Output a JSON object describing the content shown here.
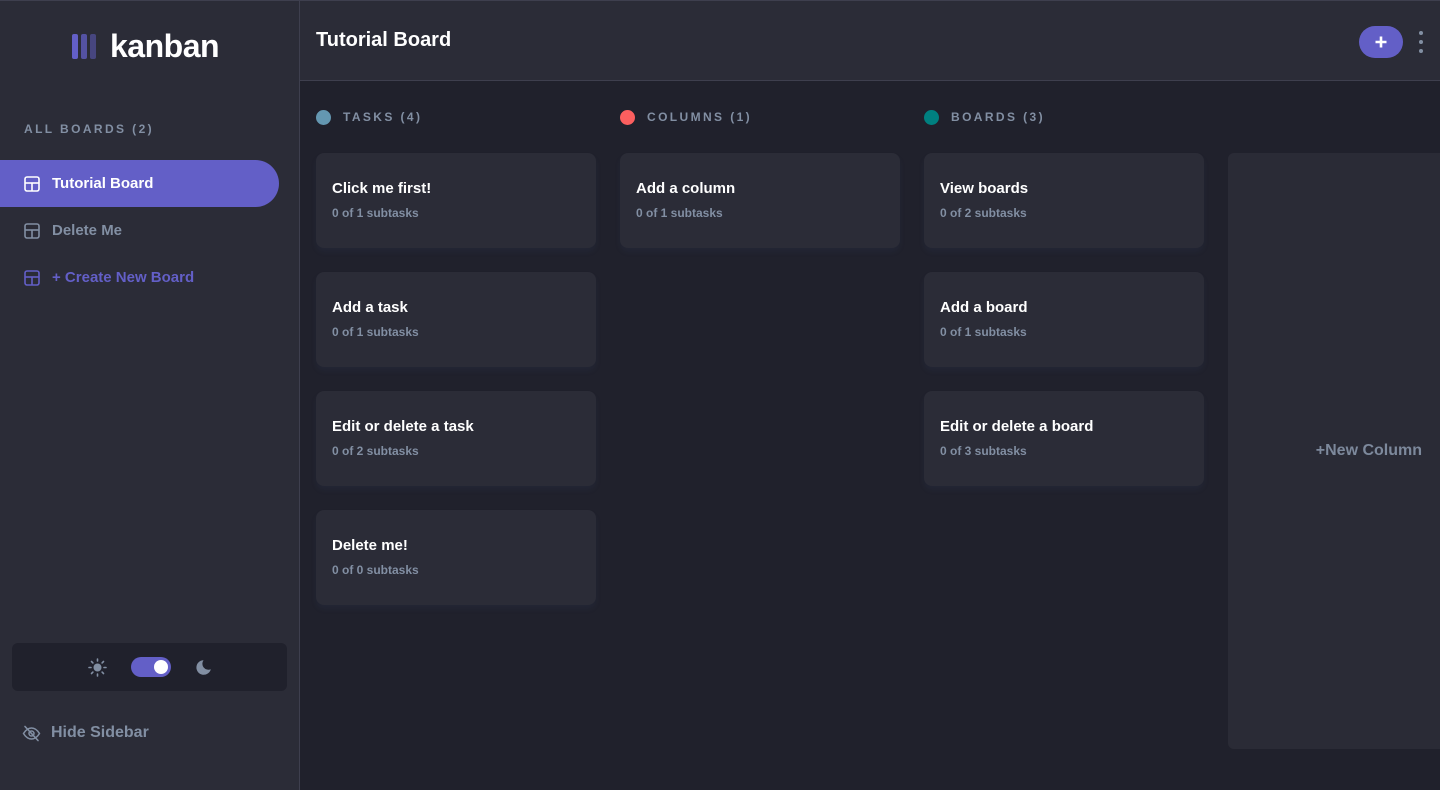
{
  "colors": {
    "accent": "#635fc7",
    "panel": "#2b2c37",
    "background": "#20212c",
    "muted_text": "#828fa3",
    "text": "#ffffff"
  },
  "logo": {
    "text": "kanban"
  },
  "sidebar": {
    "heading": "ALL BOARDS (2)",
    "boards": [
      {
        "label": "Tutorial Board",
        "active": true
      },
      {
        "label": "Delete Me",
        "active": false
      }
    ],
    "create_label": "+ Create New Board",
    "theme": {
      "mode": "dark",
      "light_icon": "sun-icon",
      "dark_icon": "moon-icon"
    },
    "hide_label": "Hide Sidebar"
  },
  "header": {
    "title": "Tutorial Board",
    "add_task_icon": "plus-icon",
    "menu_icon": "vertical-ellipsis-icon"
  },
  "columns": [
    {
      "name": "TASKS (4)",
      "color": "#6497b1",
      "tasks": [
        {
          "title": "Click me first!",
          "subtasks": "0 of 1 subtasks"
        },
        {
          "title": "Add a task",
          "subtasks": "0 of 1 subtasks"
        },
        {
          "title": "Edit or delete a task",
          "subtasks": "0 of 2 subtasks"
        },
        {
          "title": "Delete me!",
          "subtasks": "0 of 0 subtasks"
        }
      ]
    },
    {
      "name": "COLUMNS (1)",
      "color": "#fb5f5f",
      "tasks": [
        {
          "title": "Add a column",
          "subtasks": "0 of 1 subtasks"
        }
      ]
    },
    {
      "name": "BOARDS (3)",
      "color": "#008080",
      "tasks": [
        {
          "title": "View boards",
          "subtasks": "0 of 2 subtasks"
        },
        {
          "title": "Add a board",
          "subtasks": "0 of 1 subtasks"
        },
        {
          "title": "Edit or delete a board",
          "subtasks": "0 of 3 subtasks"
        }
      ]
    }
  ],
  "new_column_label": "+New Column"
}
